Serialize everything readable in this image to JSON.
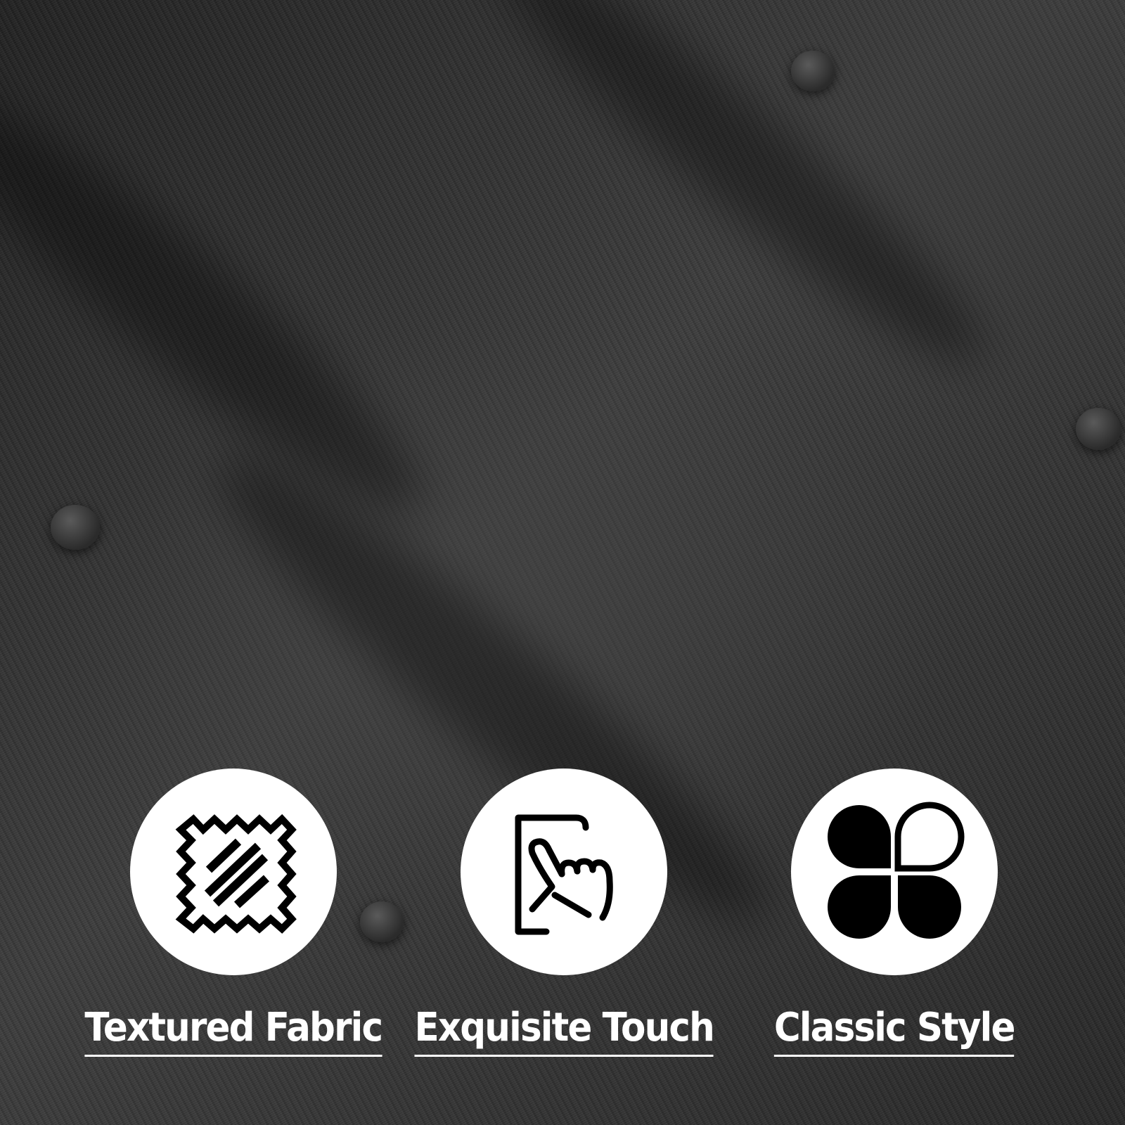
{
  "features": [
    {
      "label": "Textured Fabric",
      "icon": "fabric-swatch-icon"
    },
    {
      "label": "Exquisite Touch",
      "icon": "touch-hand-icon"
    },
    {
      "label": "Classic Style",
      "icon": "four-petal-icon"
    }
  ],
  "colors": {
    "background": "#2e2e2e",
    "circle": "#ffffff",
    "icon": "#000000",
    "text": "#ffffff"
  }
}
